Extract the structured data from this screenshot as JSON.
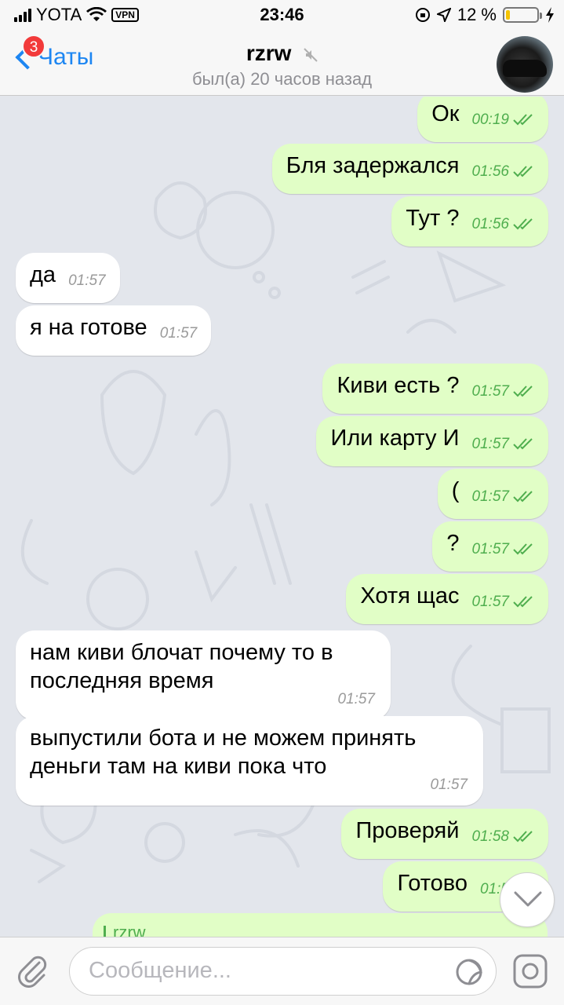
{
  "status_bar": {
    "carrier": "YOTA",
    "vpn": "VPN",
    "time": "23:46",
    "battery_percent": "12 %",
    "battery_level": 0.12
  },
  "header": {
    "back_label": "Чаты",
    "unread_badge": "3",
    "title": "rzrw",
    "subtitle": "был(а) 20 часов назад"
  },
  "messages": [
    {
      "dir": "out",
      "text": "Ок",
      "time": "00:19",
      "read": true
    },
    {
      "dir": "out",
      "text": "Бля задержался",
      "time": "01:56",
      "read": true
    },
    {
      "dir": "out",
      "text": "Тут ?",
      "time": "01:56",
      "read": true
    },
    {
      "dir": "in",
      "text": "да",
      "time": "01:57"
    },
    {
      "dir": "in",
      "text": "я на готове",
      "time": "01:57"
    },
    {
      "dir": "out",
      "text": "Киви есть ?",
      "time": "01:57",
      "read": true
    },
    {
      "dir": "out",
      "text": "Или карту И",
      "time": "01:57",
      "read": true
    },
    {
      "dir": "out",
      "text": "(",
      "time": "01:57",
      "read": true
    },
    {
      "dir": "out",
      "text": "?",
      "time": "01:57",
      "read": true
    },
    {
      "dir": "out",
      "text": "Хотя щас",
      "time": "01:57",
      "read": true
    },
    {
      "dir": "in",
      "text": "нам киви блочат почему то в последняя время",
      "time": "01:57"
    },
    {
      "dir": "in",
      "text": "выпустили бота и не можем принять деньги там на киви пока что",
      "time": "01:57"
    },
    {
      "dir": "out",
      "text": "Проверяй",
      "time": "01:58",
      "read": true
    },
    {
      "dir": "out",
      "text": "Готово",
      "time": "01:5",
      "read": true
    }
  ],
  "reply_preview": {
    "name": "rzrw"
  },
  "composer": {
    "placeholder": "Сообщение..."
  },
  "icons": {
    "back": "chevron-left-icon",
    "mute": "muted-icon",
    "scroll": "chevron-down-icon",
    "attach": "paperclip-icon",
    "sticker": "sticker-icon",
    "camera": "camera-icon",
    "read_receipt": "double-check-icon"
  },
  "colors": {
    "accent": "#1d86f2",
    "outgoing_bubble": "#e1fec6",
    "incoming_bubble": "#ffffff",
    "chat_background": "#e3e6ec",
    "time_green": "#4fae4e",
    "badge_red": "#f23a3a"
  }
}
